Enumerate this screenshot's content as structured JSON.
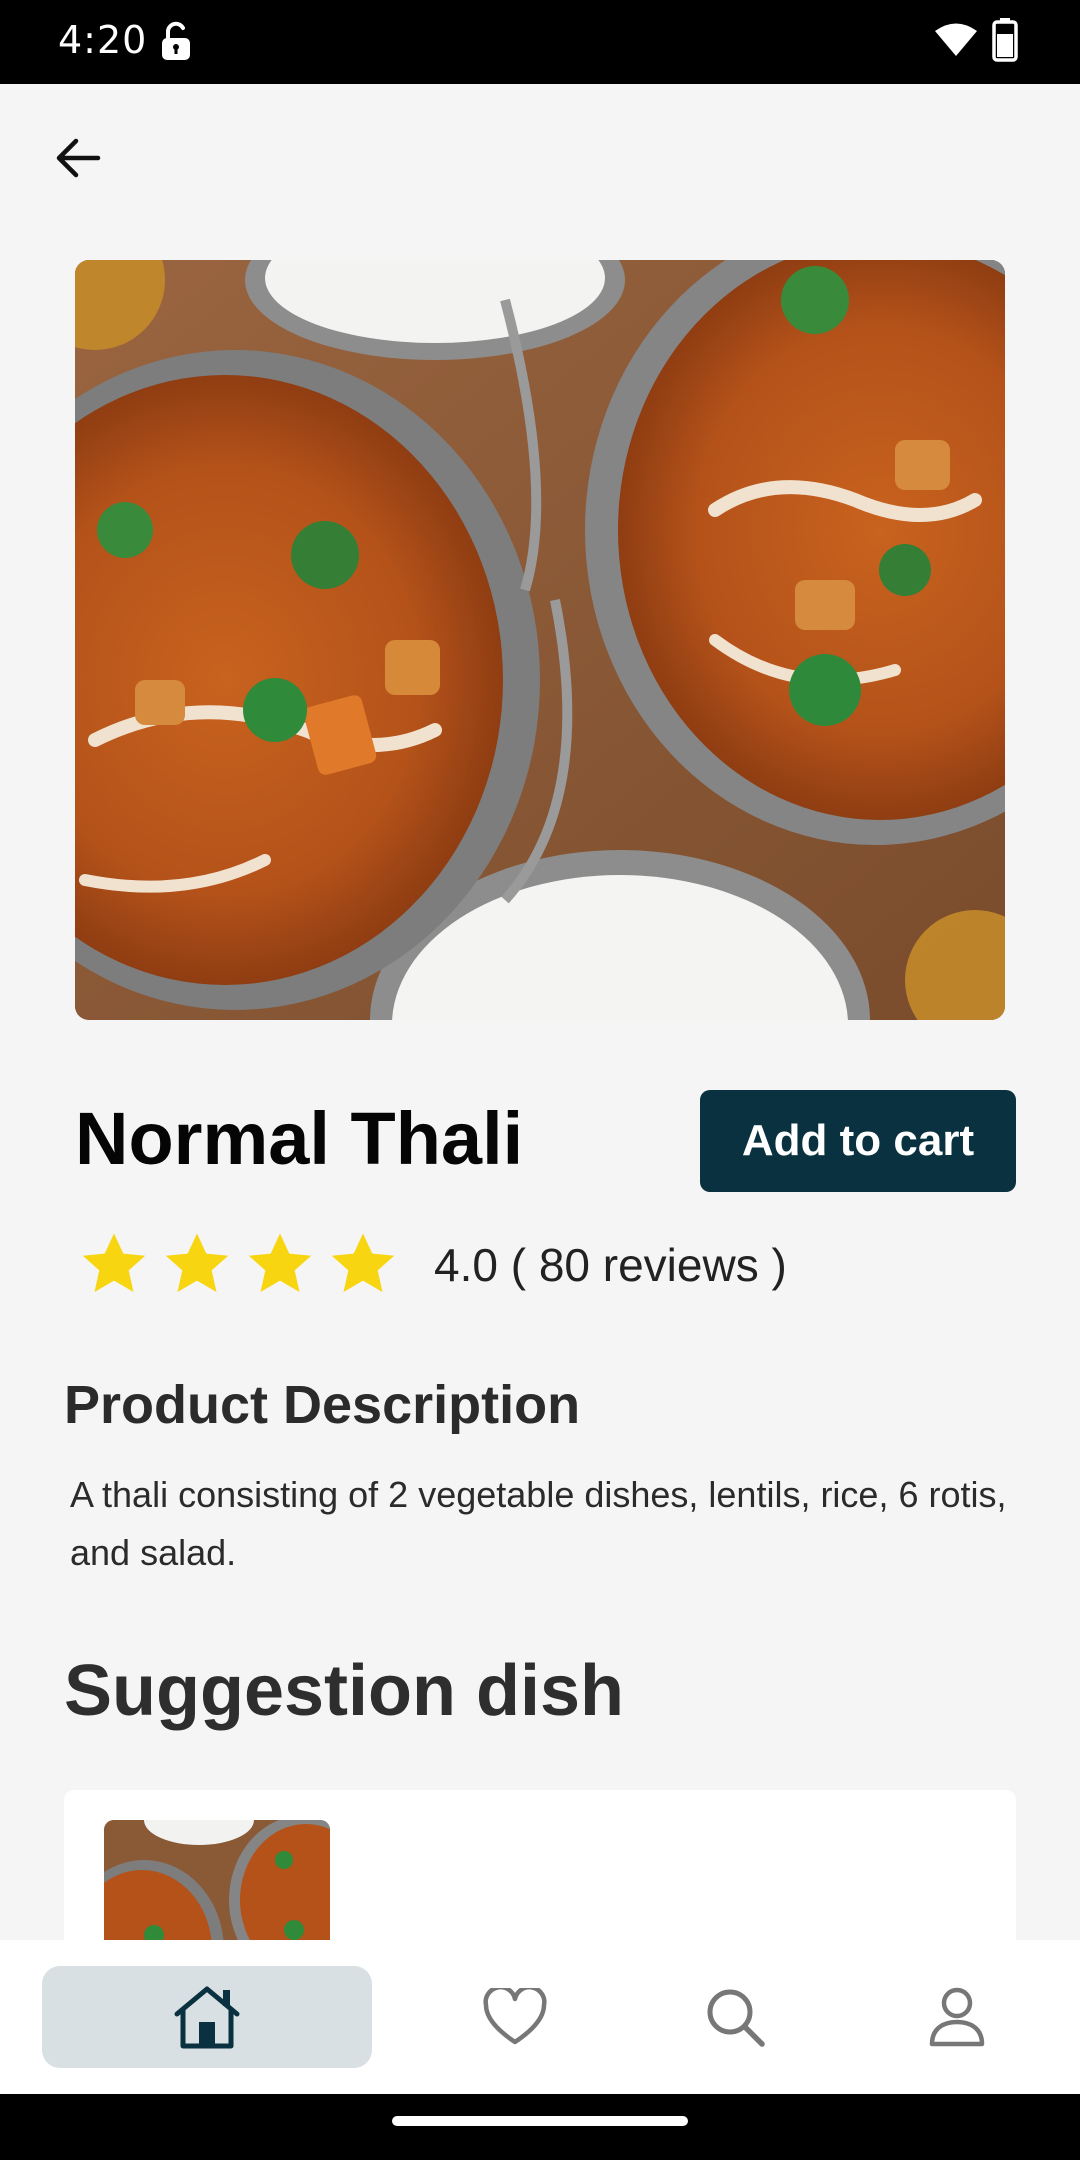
{
  "status_bar": {
    "time": "4:20",
    "icons": [
      "lock-open-icon",
      "wifi-icon",
      "battery-icon"
    ]
  },
  "header": {
    "back_icon": "arrow-left-icon"
  },
  "product": {
    "image_icon": "food-photo",
    "title": "Normal Thali",
    "add_to_cart_label": "Add to cart",
    "rating": 4.0,
    "stars_shown": 4,
    "rating_text": "4.0 ( 80 reviews )",
    "description_heading": "Product Description",
    "description": "A thali consisting of 2 vegetable dishes, lentils, rice, 6 rotis, and salad."
  },
  "suggestions": {
    "heading": "Suggestion dish"
  },
  "bottom_nav": {
    "items": [
      {
        "icon": "home-icon",
        "active": true
      },
      {
        "icon": "heart-icon",
        "active": false
      },
      {
        "icon": "search-icon",
        "active": false
      },
      {
        "icon": "profile-icon",
        "active": false
      }
    ]
  },
  "colors": {
    "primary": "#0a3140",
    "star": "#f7d511",
    "active_nav_bg": "#d8e0e3",
    "background": "#f5f5f5"
  }
}
